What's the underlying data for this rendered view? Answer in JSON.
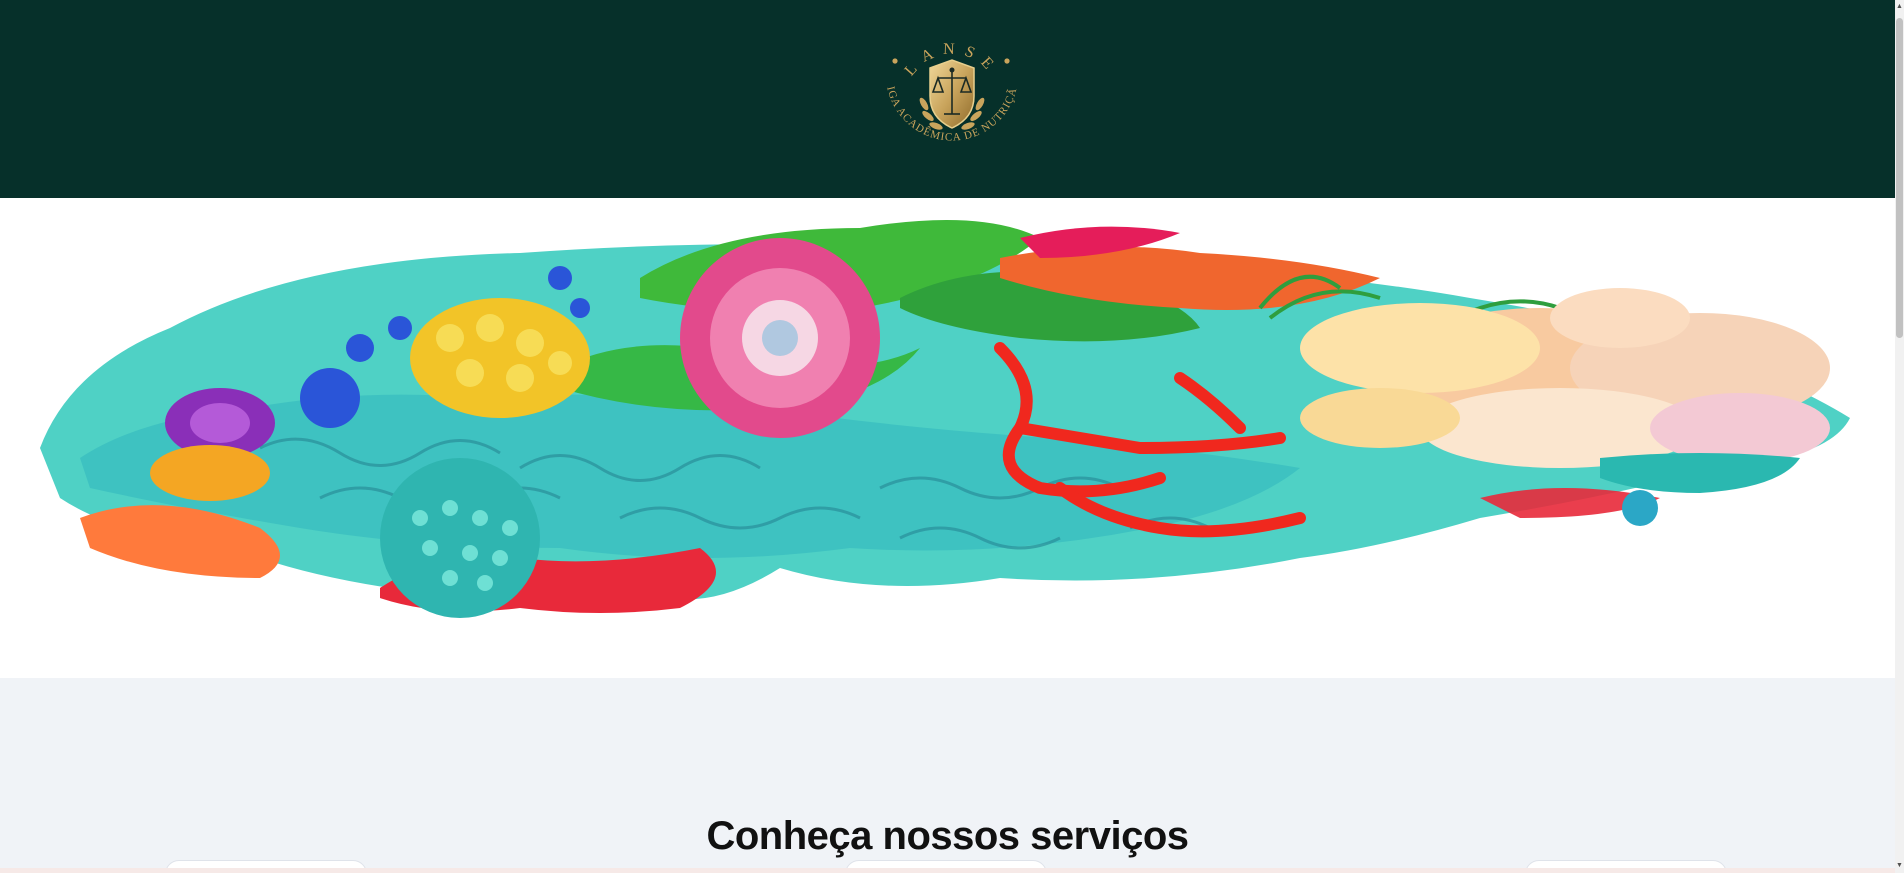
{
  "header": {
    "logo": {
      "acronym": "LANSE",
      "subtitle": "LIGA ACADÊMICA DE NUTRIÇÃO",
      "icon": "justice-scales-shield-icon"
    }
  },
  "hero": {
    "image": "brain-flowers-illustration"
  },
  "services": {
    "title": "Conheça nossos serviços"
  },
  "scrollbar": {
    "up_arrow": "▲",
    "down_arrow": "▼"
  },
  "colors": {
    "header_bg": "#06302a",
    "gold": "#c9a45c",
    "services_bg": "#f0f3f7"
  }
}
